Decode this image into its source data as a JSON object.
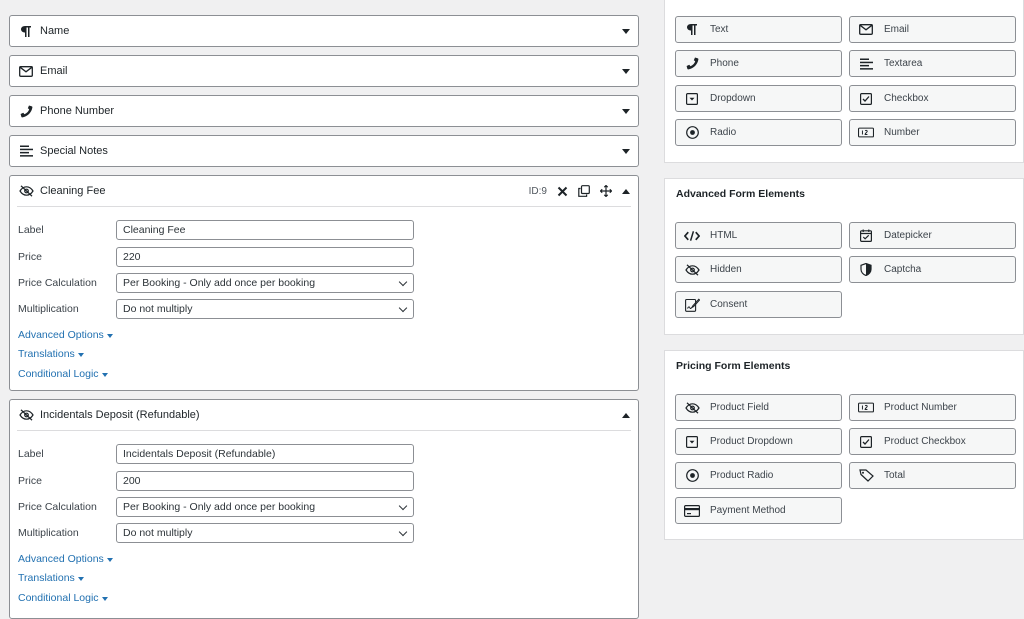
{
  "collapsed_fields": [
    {
      "title": "Name",
      "icon": "paragraph-icon"
    },
    {
      "title": "Email",
      "icon": "envelope-icon"
    },
    {
      "title": "Phone Number",
      "icon": "phone-icon"
    },
    {
      "title": "Special Notes",
      "icon": "text-lines-icon"
    }
  ],
  "cleaning_fee": {
    "title": "Cleaning Fee",
    "id_label": "ID:9",
    "label_caption": "Label",
    "label_value": "Cleaning Fee",
    "price_caption": "Price",
    "price_value": "220",
    "calc_caption": "Price Calculation",
    "calc_value": "Per Booking - Only add once per booking",
    "mult_caption": "Multiplication",
    "mult_value": "Do not multiply",
    "advanced": "Advanced Options",
    "translations": "Translations",
    "conditional": "Conditional Logic"
  },
  "deposit": {
    "title": "Incidentals Deposit (Refundable)",
    "label_caption": "Label",
    "label_value": "Incidentals Deposit (Refundable)",
    "price_caption": "Price",
    "price_value": "200",
    "calc_caption": "Price Calculation",
    "calc_value": "Per Booking - Only add once per booking",
    "mult_caption": "Multiplication",
    "mult_value": "Do not multiply",
    "advanced": "Advanced Options",
    "translations": "Translations",
    "conditional": "Conditional Logic"
  },
  "basic_elements": {
    "text": "Text",
    "email": "Email",
    "phone": "Phone",
    "textarea": "Textarea",
    "dropdown": "Dropdown",
    "checkbox": "Checkbox",
    "radio": "Radio",
    "number": "Number"
  },
  "advanced_elements": {
    "title": "Advanced Form Elements",
    "html": "HTML",
    "datepicker": "Datepicker",
    "hidden": "Hidden",
    "captcha": "Captcha",
    "consent": "Consent"
  },
  "pricing_elements": {
    "title": "Pricing Form Elements",
    "product_field": "Product Field",
    "product_number": "Product Number",
    "product_dropdown": "Product Dropdown",
    "product_checkbox": "Product Checkbox",
    "product_radio": "Product Radio",
    "total": "Total",
    "payment_method": "Payment Method"
  },
  "colors": {
    "link": "#2271b1",
    "border": "#8c8f94",
    "background": "#f0f0f1"
  }
}
